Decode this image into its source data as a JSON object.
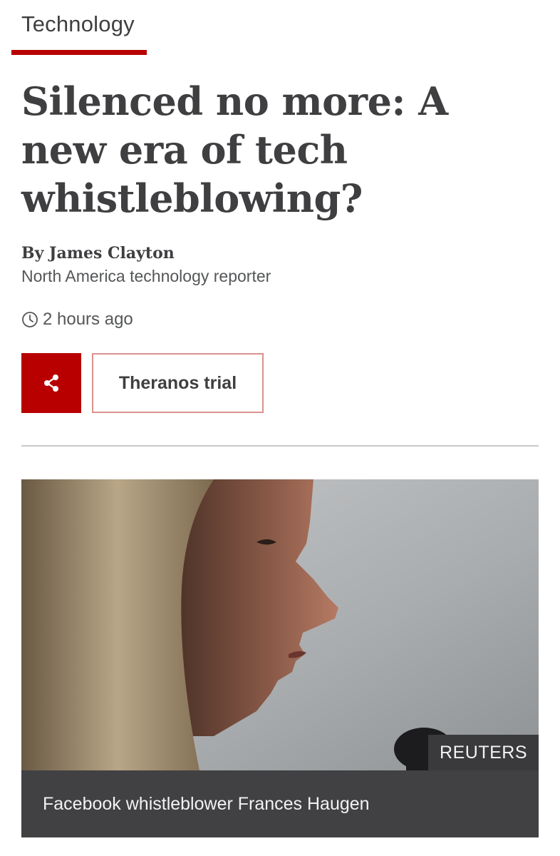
{
  "section": {
    "label": "Technology",
    "accent_color": "#b80000"
  },
  "article": {
    "headline": "Silenced no more: A new era of tech whistleblowing?",
    "byline": "By James Clayton",
    "byline_role": "North America technology reporter",
    "timestamp": "2 hours ago",
    "timestamp_icon": "clock-icon"
  },
  "actions": {
    "share_icon": "share-icon",
    "topic_label": "Theranos trial"
  },
  "figure": {
    "credit": "REUTERS",
    "caption": "Facebook whistleblower Frances Haugen"
  }
}
